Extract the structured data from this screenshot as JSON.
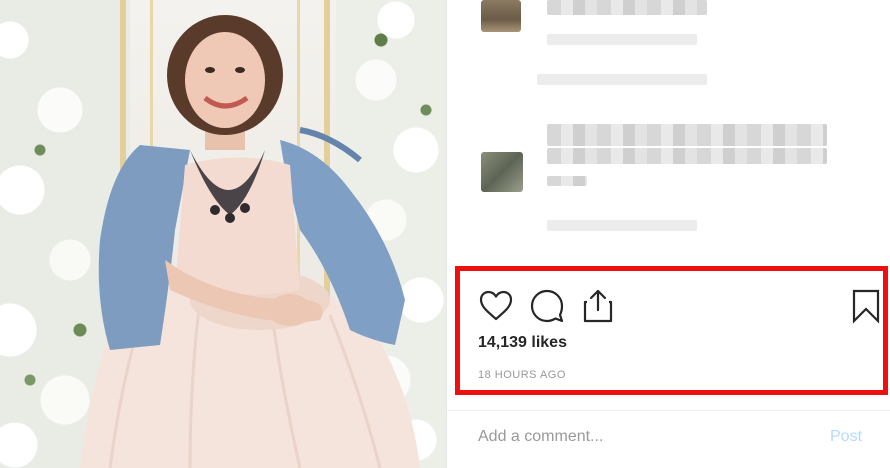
{
  "post_image": {
    "description_icon": "photo-icon",
    "background_color": "#f2f0ec"
  },
  "comments": {
    "items": [
      {
        "id": "comment-1",
        "blurred": true
      },
      {
        "id": "comment-2",
        "blurred": true
      }
    ]
  },
  "actions": {
    "like_icon": "heart-icon",
    "comment_icon": "speech-bubble-icon",
    "share_icon": "share-icon",
    "save_icon": "bookmark-icon"
  },
  "post": {
    "likes": "14,139 likes",
    "timestamp": "18 HOURS AGO"
  },
  "comment_box": {
    "placeholder": "Add a comment...",
    "post_label": "Post"
  },
  "colors": {
    "highlight": "#ee0f0f",
    "text": "#262626",
    "muted": "#999999",
    "post_disabled": "#b3dbff"
  }
}
